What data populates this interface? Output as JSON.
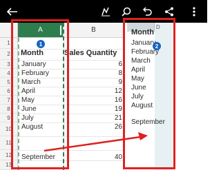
{
  "toolbar": {
    "icons": [
      "back-arrow-icon",
      "pen-icon",
      "search-icon",
      "undo-icon",
      "share-icon",
      "more-icon"
    ]
  },
  "sheet": {
    "col_a": "A",
    "col_b": "B",
    "rows": [
      "1",
      "2",
      "3",
      "4",
      "5",
      "6",
      "7",
      "8",
      "9",
      "10",
      "11",
      "12",
      "13"
    ],
    "headers": {
      "month": "Month",
      "sales_quantity": "Sales Quantity"
    },
    "months": [
      "January",
      "February",
      "March",
      "April",
      "May",
      "June",
      "July",
      "August",
      "September"
    ],
    "quantities": [
      "6",
      "8",
      "9",
      "12",
      "16",
      "19",
      "21",
      "26",
      "40"
    ]
  },
  "pasted": {
    "col_d": "D",
    "header": "Month",
    "months": [
      "January",
      "February",
      "March",
      "April",
      "May",
      "June",
      "July",
      "August",
      "September"
    ]
  },
  "annotations": {
    "badge_1": "1",
    "badge_2": "2"
  },
  "colors": {
    "selection": "#2e7d4f",
    "highlight": "#e02020",
    "badge": "#1565c0"
  }
}
